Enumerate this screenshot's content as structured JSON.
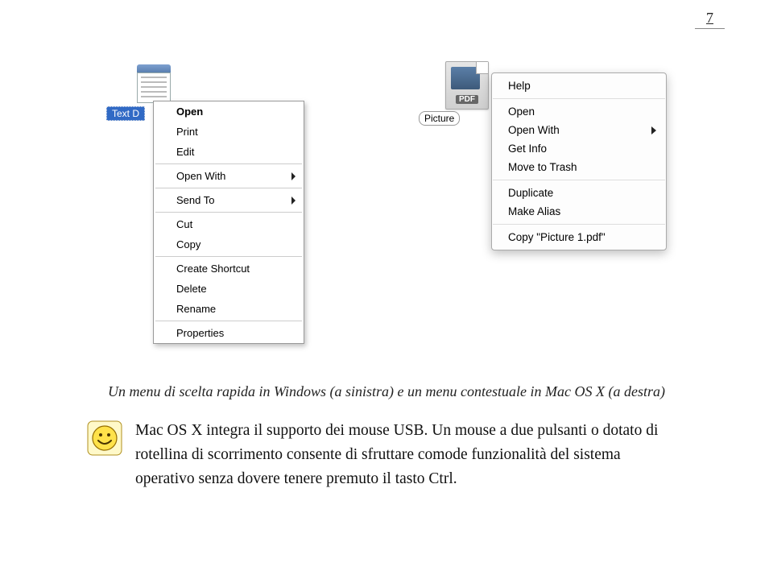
{
  "page_number": "7",
  "windows": {
    "file_label": "Text D",
    "menu": {
      "open": "Open",
      "print": "Print",
      "edit": "Edit",
      "open_with": "Open With",
      "send_to": "Send To",
      "cut": "Cut",
      "copy": "Copy",
      "create_shortcut": "Create Shortcut",
      "delete": "Delete",
      "rename": "Rename",
      "properties": "Properties"
    }
  },
  "mac": {
    "file_label": "Picture",
    "pdf_tag": "PDF",
    "menu": {
      "help": "Help",
      "open": "Open",
      "open_with": "Open With",
      "get_info": "Get Info",
      "move_to_trash": "Move to Trash",
      "duplicate": "Duplicate",
      "make_alias": "Make Alias",
      "copy_picture": "Copy \"Picture 1.pdf\""
    }
  },
  "caption": "Un menu di scelta rapida in Windows (a sinistra) e un menu contestuale in Mac OS X (a destra)",
  "tip": "Mac OS X integra il supporto dei mouse USB. Un mouse a due pulsanti o dotato di rotellina di scorrimento consente di sfruttare comode funzionalità del sistema operativo senza dovere tenere premuto il tasto Ctrl."
}
